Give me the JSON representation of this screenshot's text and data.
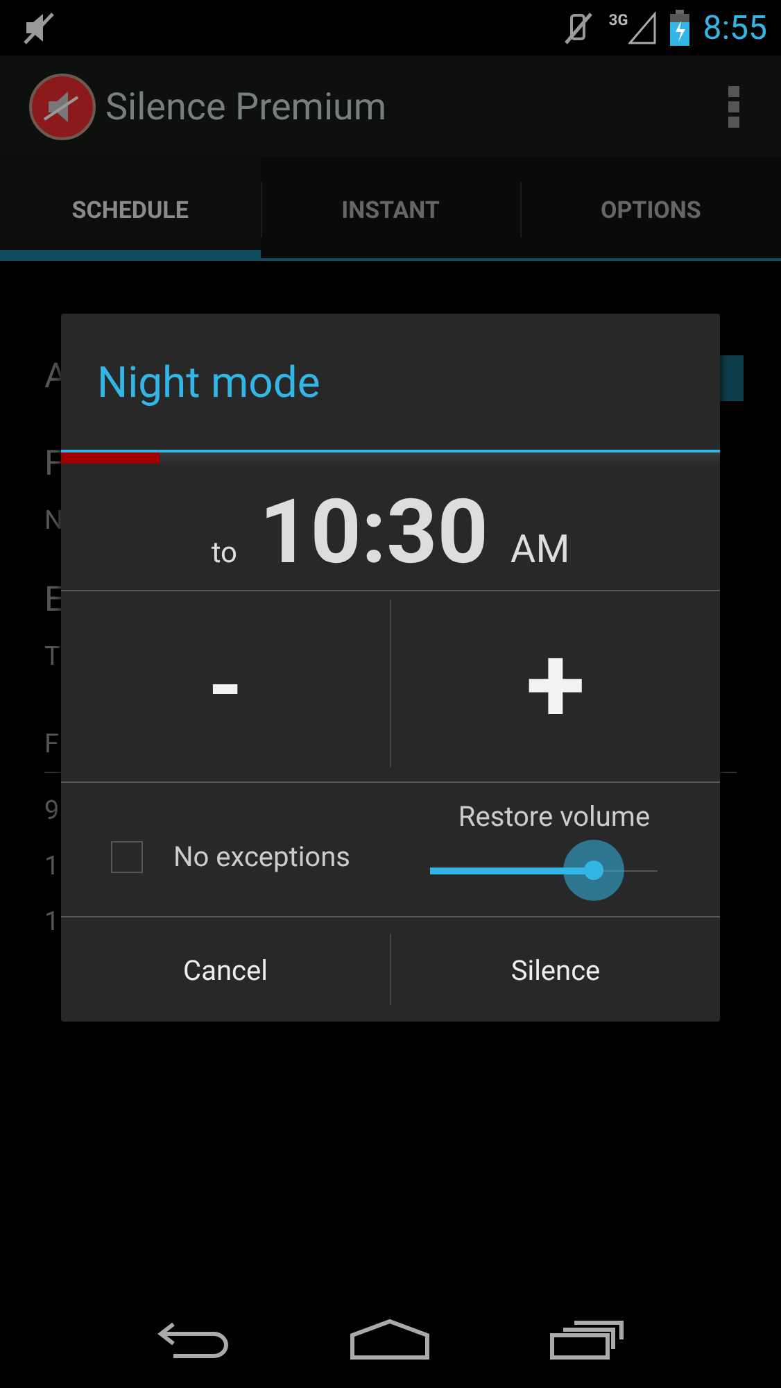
{
  "status_bar": {
    "network": "3G",
    "time": "8:55"
  },
  "app_bar": {
    "title": "Silence Premium"
  },
  "tabs": [
    {
      "label": "SCHEDULE",
      "selected": true
    },
    {
      "label": "INSTANT",
      "selected": false
    },
    {
      "label": "OPTIONS",
      "selected": false
    }
  ],
  "background_list": [
    {
      "kind": "title",
      "text": "A"
    },
    {
      "kind": "title",
      "text": "F"
    },
    {
      "kind": "subtitle",
      "text": "N"
    },
    {
      "kind": "title",
      "text": "E"
    },
    {
      "kind": "subtitle",
      "text": "T"
    },
    {
      "kind": "header",
      "text": "F"
    },
    {
      "kind": "item",
      "text": "9"
    },
    {
      "kind": "item",
      "text": "1"
    },
    {
      "kind": "item",
      "text": "1"
    }
  ],
  "dialog": {
    "title": "Night mode",
    "progress": {
      "level": 0.15
    },
    "time_prefix": "to",
    "time": "10:30",
    "meridiem": "AM",
    "decrement": "-",
    "increment": "+",
    "checkbox": {
      "label": "No exceptions",
      "checked": false
    },
    "slider": {
      "label": "Restore volume",
      "level": 0.72
    },
    "buttons": [
      "Cancel",
      "Silence"
    ]
  }
}
